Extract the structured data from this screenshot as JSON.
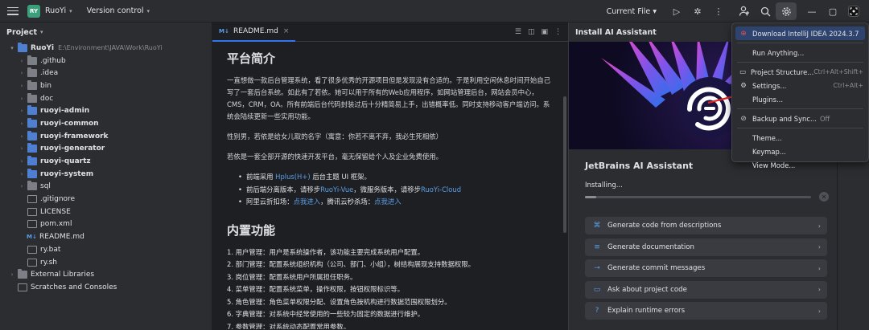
{
  "titlebar": {
    "project_badge": "RY",
    "project_name": "RuoYi",
    "vcs": "Version control",
    "current_file": "Current File"
  },
  "sidebar": {
    "title": "Project",
    "root": {
      "name": "RuoYi",
      "path": "E:\\Environment\\JAVA\\Work\\RuoYi"
    },
    "items": [
      {
        "name": ".github",
        "kind": "folder",
        "bold": false
      },
      {
        "name": ".idea",
        "kind": "folder",
        "bold": false
      },
      {
        "name": "bin",
        "kind": "folder",
        "bold": false
      },
      {
        "name": "doc",
        "kind": "folder",
        "bold": false
      },
      {
        "name": "ruoyi-admin",
        "kind": "module",
        "bold": true
      },
      {
        "name": "ruoyi-common",
        "kind": "module",
        "bold": true
      },
      {
        "name": "ruoyi-framework",
        "kind": "module",
        "bold": true
      },
      {
        "name": "ruoyi-generator",
        "kind": "module",
        "bold": true
      },
      {
        "name": "ruoyi-quartz",
        "kind": "module",
        "bold": true
      },
      {
        "name": "ruoyi-system",
        "kind": "module",
        "bold": true
      },
      {
        "name": "sql",
        "kind": "folder",
        "bold": false
      },
      {
        "name": ".gitignore",
        "kind": "file",
        "bold": false
      },
      {
        "name": "LICENSE",
        "kind": "file",
        "bold": false
      },
      {
        "name": "pom.xml",
        "kind": "file",
        "bold": false
      },
      {
        "name": "README.md",
        "kind": "md",
        "bold": false
      },
      {
        "name": "ry.bat",
        "kind": "file",
        "bold": false
      },
      {
        "name": "ry.sh",
        "kind": "file",
        "bold": false
      }
    ],
    "external_libraries": "External Libraries",
    "scratches": "Scratches and Consoles"
  },
  "editor": {
    "tab": {
      "icon_label": "M↓",
      "label": "README.md",
      "close": "×"
    },
    "h_intro": "平台简介",
    "p1": "一直想做一款后台管理系统，看了很多优秀的开源项目但是发现没有合适的。于是利用空闲休息时间开始自己写了一套后台系统。如此有了若依。她可以用于所有的Web应用程序，如网站管理后台，网站会员中心，CMS，CRM，OA。所有前端后台代码封装过后十分精简易上手，出错概率低。同时支持移动客户端访问。系统会陆续更新一些实用功能。",
    "p2": "性别男，若依是给女儿取的名字（寓意：你若不离不弃，我必生死相依）",
    "p3": "若依是一套全部开源的快速开发平台，毫无保留给个人及企业免费使用。",
    "b1_pre": "前端采用",
    "b1_link": "Hplus(H+)",
    "b1_post": "后台主题 UI 框架。",
    "b2_pre": "前后端分离版本，请移步",
    "b2_link1": "RuoYi-Vue",
    "b2_mid": "，微服务版本，请移步",
    "b2_link2": "RuoYi-Cloud",
    "b3_pre": "阿里云折扣场：",
    "b3_link1": "点我进入",
    "b3_mid": "，腾讯云秒杀场：",
    "b3_link2": "点我进入",
    "h_features": "内置功能",
    "features": [
      "1. 用户管理：用户是系统操作者，该功能主要完成系统用户配置。",
      "2. 部门管理：配置系统组织机构（公司、部门、小组），树结构展现支持数据权限。",
      "3. 岗位管理：配置系统用户所属担任职务。",
      "4. 菜单管理：配置系统菜单，操作权限，按钮权限标识等。",
      "5. 角色管理：角色菜单权限分配、设置角色按机构进行数据范围权限划分。",
      "6. 字典管理：对系统中经常使用的一些较为固定的数据进行维护。",
      "7. 参数管理：对系统动态配置常用参数。",
      "8. 通知公告：系统通知公告信息发布维护。"
    ]
  },
  "ai": {
    "header": "Install AI Assistant",
    "title": "JetBrains AI Assistant",
    "status": "Installing...",
    "progress": 0.05,
    "features": [
      {
        "label": "Generate code from descriptions",
        "icon": "code-icon"
      },
      {
        "label": "Generate documentation",
        "icon": "doc-icon"
      },
      {
        "label": "Generate commit messages",
        "icon": "commit-icon"
      },
      {
        "label": "Ask about project code",
        "icon": "chat-icon"
      },
      {
        "label": "Explain runtime errors",
        "icon": "question-icon"
      }
    ]
  },
  "menu": {
    "download": "Download IntelliJ IDEA 2024.3.7",
    "run_anything": "Run Anything...",
    "project_structure": "Project Structure...",
    "project_structure_sc": "Ctrl+Alt+Shift+",
    "settings": "Settings...",
    "settings_sc": "Ctrl+Alt+",
    "plugins": "Plugins...",
    "backup": "Backup and Sync...",
    "backup_state": "Off",
    "theme": "Theme...",
    "keymap": "Keymap...",
    "view_mode": "View Mode..."
  },
  "colors": {
    "accent": "#3574f0",
    "link": "#5a9ee9",
    "highlight": "#2e436e",
    "arrow": "#e02424"
  }
}
